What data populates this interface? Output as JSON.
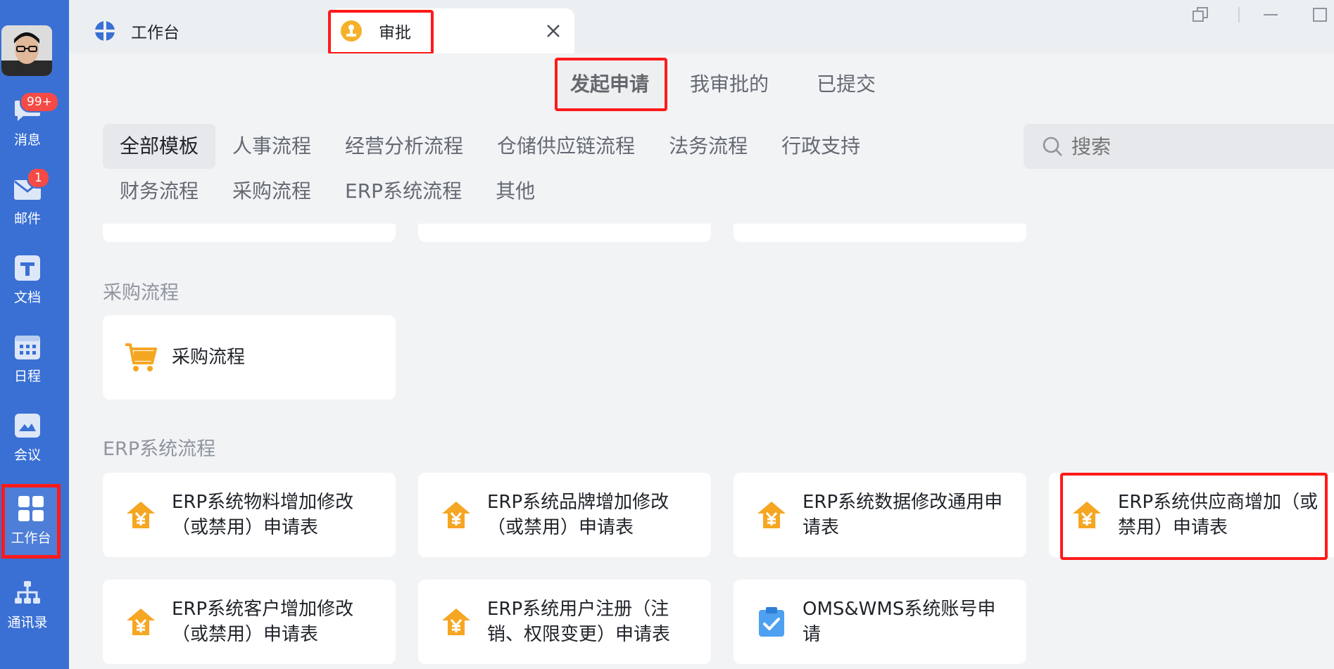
{
  "sidebar": {
    "items": [
      {
        "label": "消息",
        "badge": "99+",
        "icon": "chat-bubble-icon"
      },
      {
        "label": "邮件",
        "badge": "1",
        "icon": "mail-icon"
      },
      {
        "label": "文档",
        "icon": "document-icon"
      },
      {
        "label": "日程",
        "icon": "calendar-icon"
      },
      {
        "label": "会议",
        "icon": "meeting-icon"
      },
      {
        "label": "工作台",
        "icon": "workbench-grid-icon",
        "active": true
      },
      {
        "label": "通讯录",
        "icon": "org-chart-icon"
      }
    ]
  },
  "tabs": [
    {
      "label": "工作台",
      "icon": "workbench-logo-icon"
    },
    {
      "label": "审批",
      "icon": "approval-stamp-icon",
      "active": true
    }
  ],
  "top_tabs": [
    "发起申请",
    "我审批的",
    "已提交"
  ],
  "categories_row1": [
    "全部模板",
    "人事流程",
    "经营分析流程",
    "仓储供应链流程",
    "法务流程",
    "行政支持"
  ],
  "categories_row2": [
    "财务流程",
    "采购流程",
    "ERP系统流程",
    "其他"
  ],
  "search": {
    "placeholder": "搜索"
  },
  "sections": {
    "purchase": {
      "title": "采购流程",
      "items": [
        {
          "label": "采购流程",
          "icon": "shopping-cart-icon"
        }
      ]
    },
    "erp": {
      "title": "ERP系统流程",
      "items": [
        {
          "label": "ERP系统物料增加修改（或禁用）申请表",
          "icon": "finance-yen-icon"
        },
        {
          "label": "ERP系统品牌增加修改（或禁用）申请表",
          "icon": "finance-yen-icon"
        },
        {
          "label": "ERP系统数据修改通用申请表",
          "icon": "finance-yen-icon"
        },
        {
          "label": "ERP系统供应商增加（或禁用）申请表",
          "icon": "finance-yen-icon"
        },
        {
          "label": "ERP系统客户增加修改（或禁用）申请表",
          "icon": "finance-yen-icon"
        },
        {
          "label": "ERP系统用户注册（注销、权限变更）申请表",
          "icon": "finance-yen-icon"
        },
        {
          "label": "OMS&WMS系统账号申请",
          "icon": "clipboard-check-icon"
        }
      ]
    }
  },
  "colors": {
    "sidebar": "#3a70d4",
    "highlight": "#ff1a1a",
    "accent_orange": "#f5a623",
    "accent_blue": "#4ea0f0"
  }
}
